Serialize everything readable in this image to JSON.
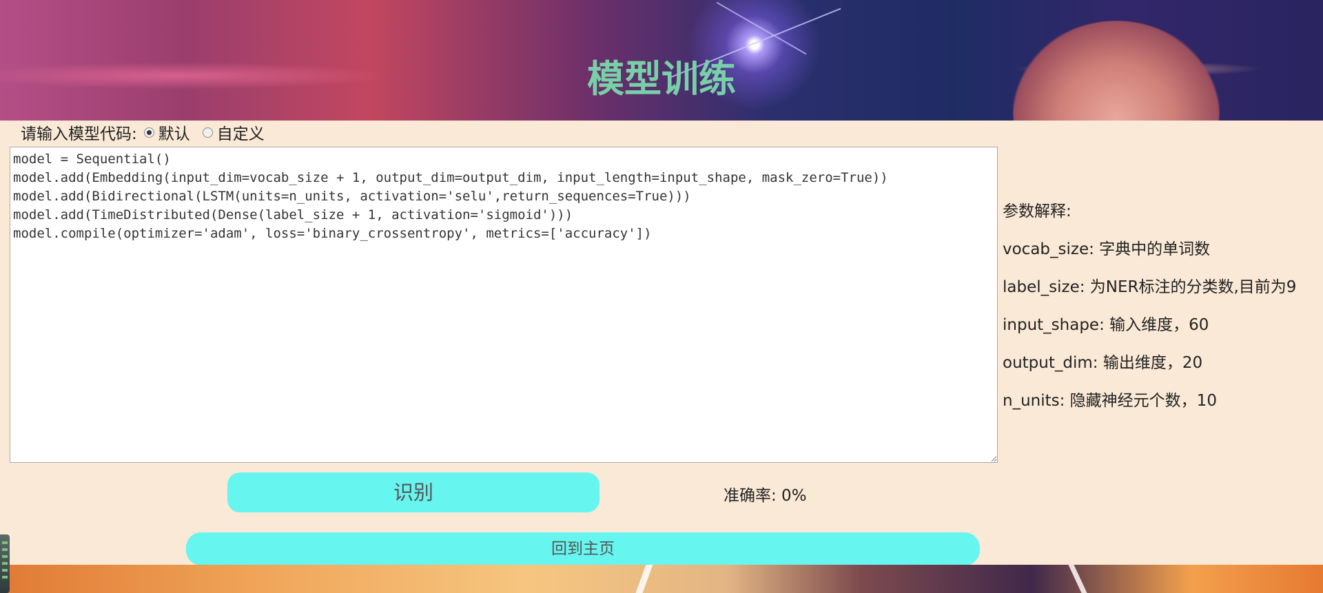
{
  "header": {
    "title": "模型训练"
  },
  "mode": {
    "prompt": "请输入模型代码:",
    "options": [
      {
        "label": "默认",
        "checked": true
      },
      {
        "label": "自定义",
        "checked": false
      }
    ]
  },
  "editor": {
    "code": "model = Sequential()\nmodel.add(Embedding(input_dim=vocab_size + 1, output_dim=output_dim, input_length=input_shape, mask_zero=True))\nmodel.add(Bidirectional(LSTM(units=n_units, activation='selu',return_sequences=True)))\nmodel.add(TimeDistributed(Dense(label_size + 1, activation='sigmoid')))\nmodel.compile(optimizer='adam', loss='binary_crossentropy', metrics=['accuracy'])"
  },
  "params": {
    "heading": "参数解释:",
    "items": [
      "vocab_size: 字典中的单词数",
      "label_size: 为NER标注的分类数,目前为9",
      "input_shape: 输入维度，60",
      "output_dim: 输出维度，20",
      "n_units: 隐藏神经元个数，10"
    ]
  },
  "actions": {
    "recognize_label": "识别",
    "accuracy_text": "准确率: 0%",
    "home_label": "回到主页"
  },
  "colors": {
    "accent": "#67f5ef",
    "title": "#79cfa8",
    "background": "#fae9d6"
  }
}
